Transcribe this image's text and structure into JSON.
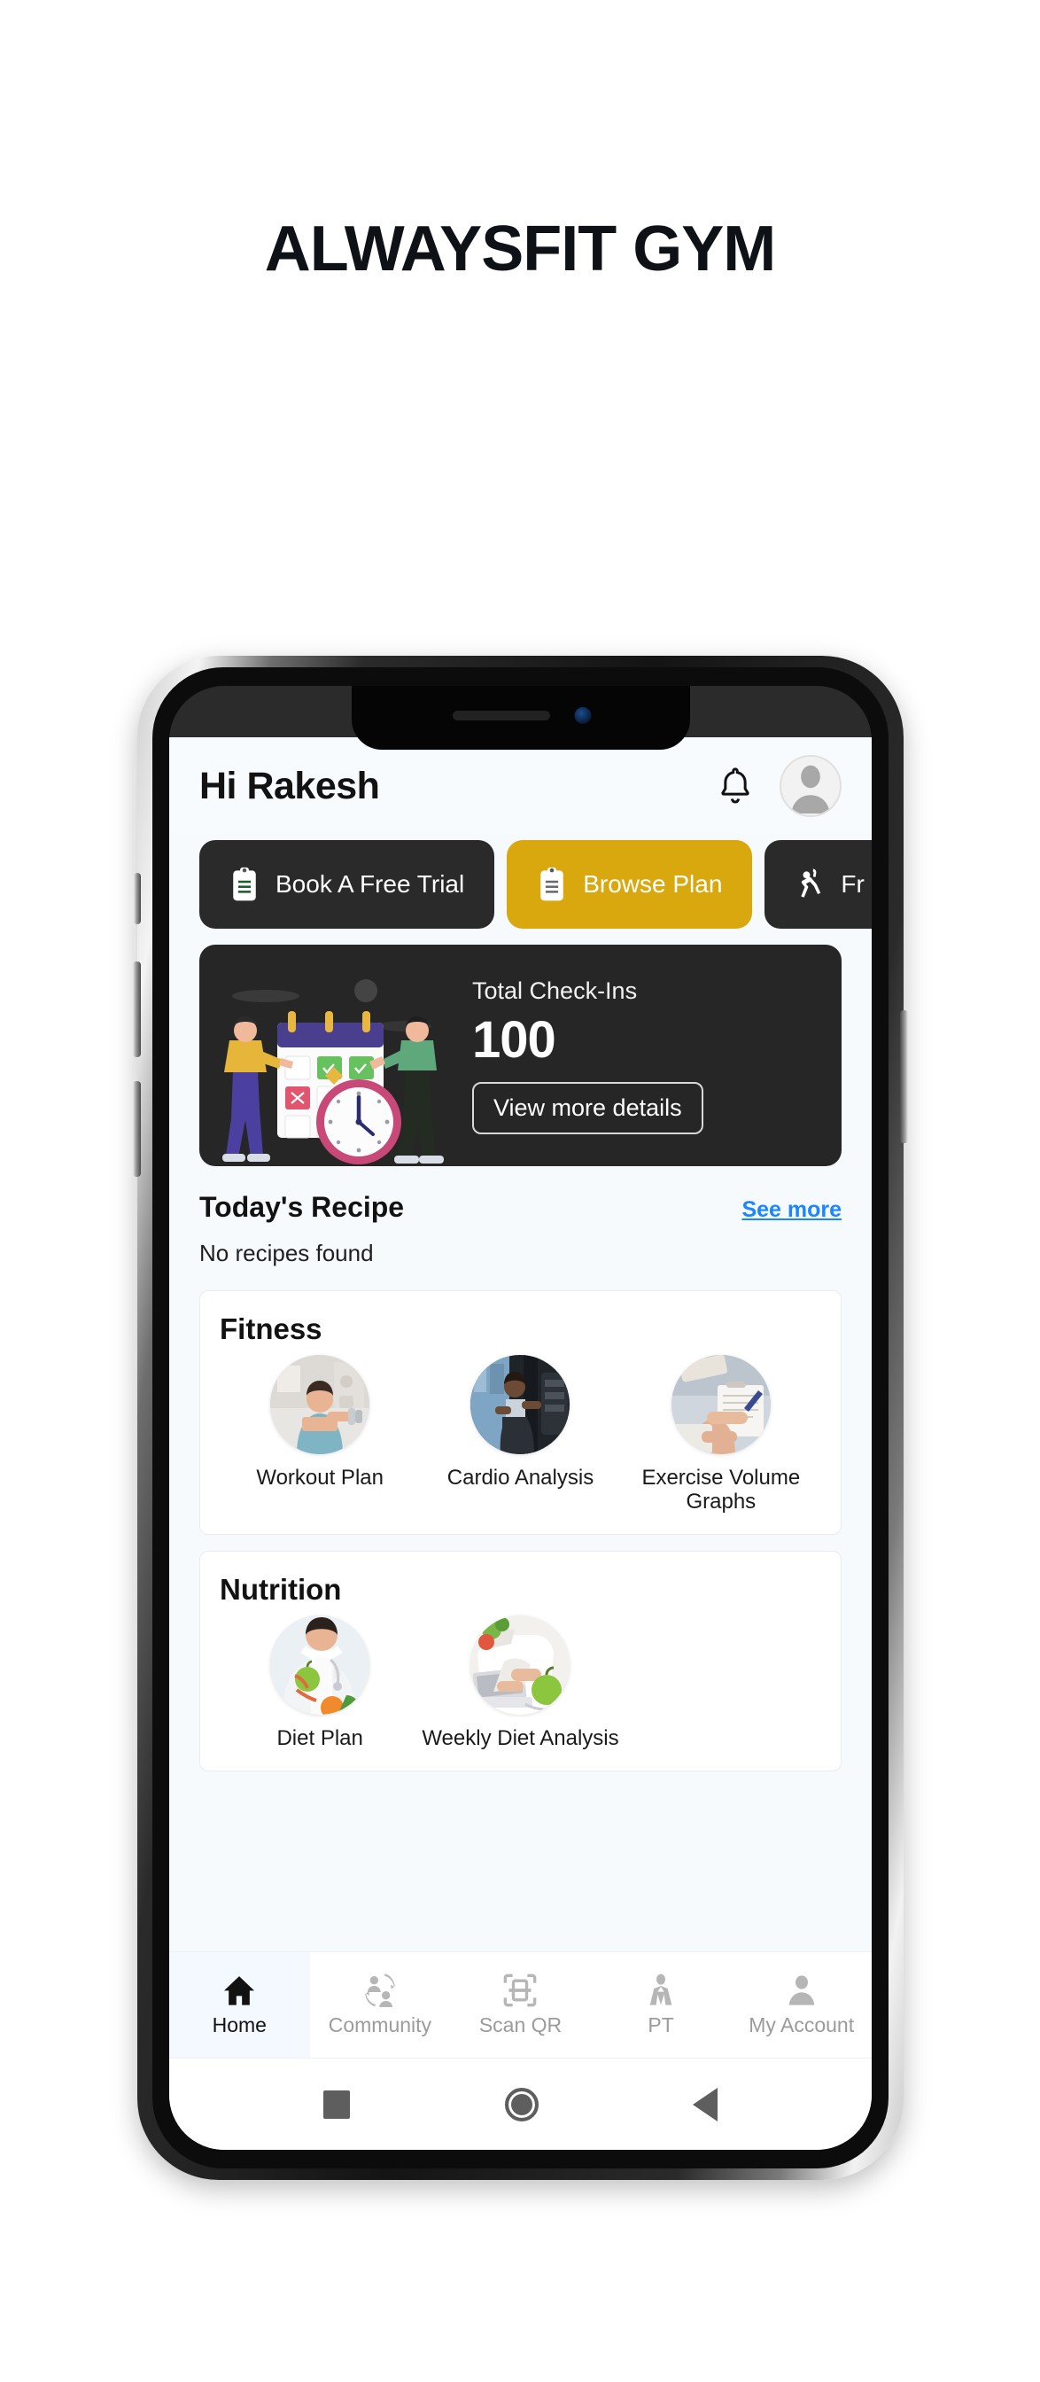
{
  "banner": {
    "title": "ALWAYSFIT GYM"
  },
  "app": {
    "header": {
      "greeting": "Hi Rakesh",
      "bell_icon": "bell-icon",
      "avatar_icon": "avatar-icon"
    },
    "quick_actions": [
      {
        "label": "Book A Free Trial",
        "icon": "clipboard-icon",
        "style": "dark"
      },
      {
        "label": "Browse Plan",
        "icon": "clipboard-icon",
        "style": "gold"
      },
      {
        "label": "Fr",
        "icon": "exercise-figure-icon",
        "style": "dark"
      }
    ],
    "checkin_card": {
      "label": "Total Check-Ins",
      "value": "100",
      "button_label": "View more details",
      "illustration": "calendar-checkin-illustration"
    },
    "recipe": {
      "title": "Today's Recipe",
      "see_more": "See more",
      "empty_text": "No recipes found"
    },
    "sections": [
      {
        "title": "Fitness",
        "tiles": [
          {
            "label": "Workout Plan",
            "image": "woman-dumbbell-photo"
          },
          {
            "label": "Cardio Analysis",
            "image": "woman-treadmill-photo"
          },
          {
            "label": "Exercise Volume Graphs",
            "image": "clipboard-writing-photo"
          }
        ]
      },
      {
        "title": "Nutrition",
        "tiles": [
          {
            "label": "Diet Plan",
            "image": "dietitian-apple-photo"
          },
          {
            "label": "Weekly Diet Analysis",
            "image": "laptop-apple-photo"
          }
        ]
      }
    ],
    "bottom_nav": [
      {
        "label": "Home",
        "icon": "home-icon",
        "active": true
      },
      {
        "label": "Community",
        "icon": "community-icon",
        "active": false
      },
      {
        "label": "Scan QR",
        "icon": "scan-qr-icon",
        "active": false
      },
      {
        "label": "PT",
        "icon": "trainer-icon",
        "active": false
      },
      {
        "label": "My Account",
        "icon": "person-icon",
        "active": false
      }
    ],
    "system_bar": {
      "recents_icon": "recents-square-icon",
      "home_icon": "home-circle-icon",
      "back_icon": "back-triangle-icon"
    }
  },
  "colors": {
    "accent_gold": "#d9a80e",
    "dark": "#2a2a2a",
    "link_blue": "#1a86ff",
    "app_bg": "#f6fafd"
  }
}
